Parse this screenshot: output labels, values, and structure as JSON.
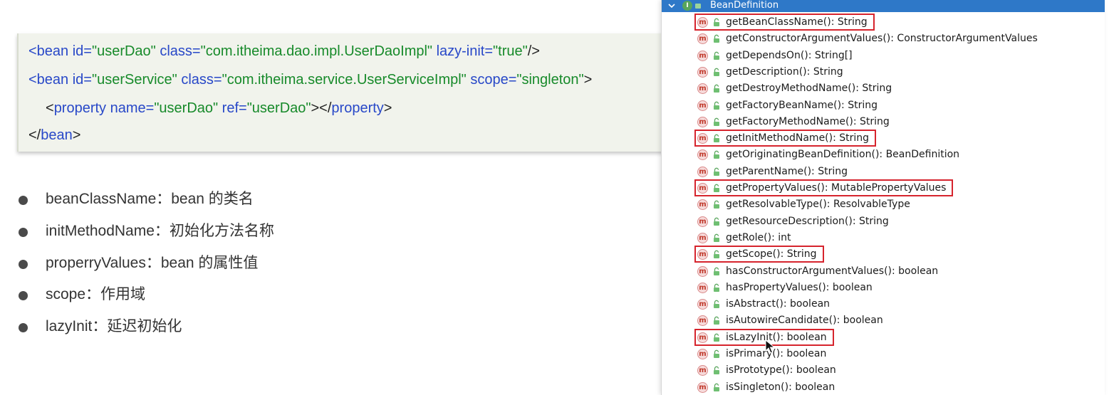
{
  "code": {
    "line1": {
      "open": "<bean",
      "a1": " id=",
      "v1": "\"userDao\"",
      "a2": " class=",
      "v2": "\"com.itheima.dao.impl.UserDaoImpl\"",
      "a3": " lazy-init=",
      "v3": "\"true\"",
      "close": "/>"
    },
    "line2": {
      "open": "<bean",
      "a1": " id=",
      "v1": "\"userService\"",
      "a2": " class=",
      "v2": "\"com.itheima.service.UserServiceImpl\"",
      "a3": " scope=",
      "v3": "\"singleton\"",
      "close": ">"
    },
    "line3": {
      "lt": "<",
      "tag": "property",
      "a1": " name=",
      "v1": "\"userDao\"",
      "a2": " ref=",
      "v2": "\"userDao\"",
      "mid": "></",
      "tag2": "property",
      "close": ">"
    },
    "line4": {
      "lt": "</",
      "tag": "bean",
      "close": ">"
    }
  },
  "bullets": [
    "beanClassName：bean 的类名",
    "initMethodName：初始化方法名称",
    "properryValues：bean 的属性值",
    "scope：作用域",
    "lazyInit：延迟初始化"
  ],
  "panel": {
    "title": "BeanDefinition",
    "interface_badge": "I",
    "method_badge": "m",
    "methods": [
      "getBeanClassName(): String",
      "getConstructorArgumentValues(): ConstructorArgumentValues",
      "getDependsOn(): String[]",
      "getDescription(): String",
      "getDestroyMethodName(): String",
      "getFactoryBeanName(): String",
      "getFactoryMethodName(): String",
      "getInitMethodName(): String",
      "getOriginatingBeanDefinition(): BeanDefinition",
      "getParentName(): String",
      "getPropertyValues(): MutablePropertyValues",
      "getResolvableType(): ResolvableType",
      "getResourceDescription(): String",
      "getRole(): int",
      "getScope(): String",
      "hasConstructorArgumentValues(): boolean",
      "hasPropertyValues(): boolean",
      "isAbstract(): boolean",
      "isAutowireCandidate(): boolean",
      "isLazyInit(): boolean",
      "isPrimary(): boolean",
      "isPrototype(): boolean",
      "isSingleton(): boolean"
    ],
    "highlighted": [
      "getBeanClassName(): String",
      "getInitMethodName(): String",
      "getPropertyValues(): MutablePropertyValues",
      "getScope(): String",
      "isLazyInit(): boolean"
    ]
  },
  "colors": {
    "header_bg": "#2e78c8",
    "highlight_border": "#d6242d",
    "code_bg": "#f1f3ec",
    "xml_tag": "#2848c8",
    "xml_value": "#178a2a"
  }
}
